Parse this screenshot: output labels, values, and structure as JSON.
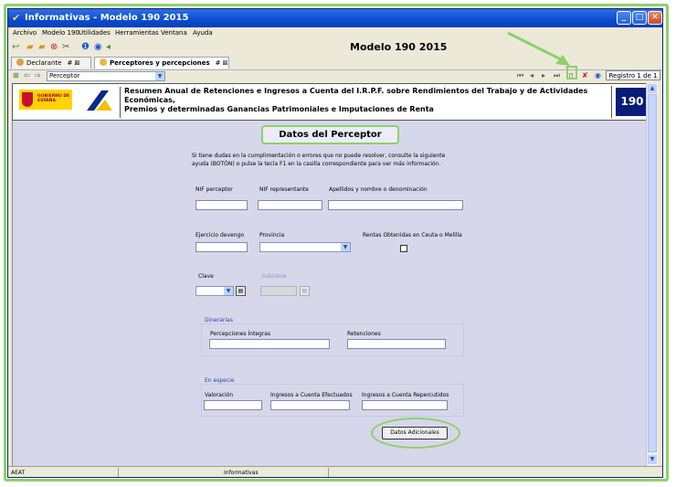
{
  "window": {
    "title": "Informativas - Modelo 190 2015"
  },
  "menu": [
    "Archivo",
    "Modelo 190",
    "Utilidades",
    "Herramientas",
    "Ventana",
    "Ayuda"
  ],
  "app_title": "Modelo 190 2015",
  "tabs": [
    {
      "label": "Declarante",
      "extra": "# ⊠"
    },
    {
      "label": "Perceptores y percepciones",
      "extra": "# ⊠"
    }
  ],
  "nav": {
    "selector_value": "Perceptor",
    "record": "Registro 1 de 1"
  },
  "header": {
    "gov_logo": "GOBIERNO DE ESPAÑA",
    "line1": "Resumen Anual de Retenciones e Ingresos a Cuenta del I.R.P.F. sobre Rendimientos del Trabajo y de Actividades Económicas,",
    "line2": "Premios y determinadas Ganancias Patrimoniales e Imputaciones de Renta",
    "number": "190"
  },
  "form": {
    "title": "Datos del Perceptor",
    "help_line1": "Si tiene dudas en la cumplimentación o errores que no puede resolver, consulte la siguiente",
    "help_line2": "ayuda (BOTÓN) o pulse la tecla F1 en la casilla correspondiente para ver más información.",
    "nif_perceptor": "NIF perceptor",
    "nif_representante": "NIF representante",
    "apellidos": "Apellidos y nombre o denominación",
    "ejercicio": "Ejercicio devengo",
    "provincia": "Provincia",
    "rentas_ceuta": "Rentas Obtenidas en Ceuta o Melilla",
    "clave": "Clave",
    "subclave": "Subclave",
    "dinerarias": "Dinerarias",
    "percepciones_integras": "Percepciones Íntegras",
    "retenciones": "Retenciones",
    "en_especie": "En especie",
    "valoracion": "Valoración",
    "ingresos_efectuados": "Ingresos a Cuenta Efectuados",
    "ingresos_repercutidos": "Ingresos a Cuenta Repercutidos",
    "datos_adicionales": "Datos Adicionales"
  },
  "status": {
    "left": "AEAT",
    "middle": "Informativas"
  },
  "colors": {
    "annotation": "#8fd06a",
    "titlebar": "#0a4bd0",
    "content_bg": "#d6d7ea"
  }
}
